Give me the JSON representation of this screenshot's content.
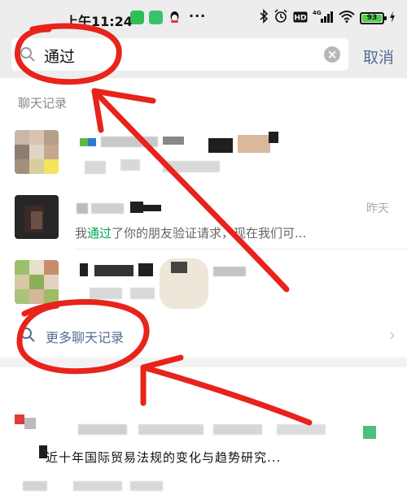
{
  "status_bar": {
    "time": "上午11:24",
    "more": "···",
    "battery": "93",
    "icons": [
      "wechat-icon",
      "green-app-icon",
      "qq-icon",
      "bluetooth-icon",
      "alarm-icon",
      "hd-icon",
      "signal-4g-icon",
      "wifi-icon",
      "battery-icon",
      "charging-icon"
    ]
  },
  "search": {
    "query": "通过",
    "cancel_label": "取消"
  },
  "section_title": "聊天记录",
  "results": [
    {
      "time": "",
      "snippet_pre": "",
      "snippet_hl": "",
      "snippet_post": ""
    },
    {
      "time": "昨天",
      "snippet_pre": "我",
      "snippet_hl": "通过",
      "snippet_post": "了你的朋友验证请求，现在我们可..."
    },
    {
      "time": "",
      "snippet_pre": "",
      "snippet_hl": "",
      "snippet_post": ""
    }
  ],
  "more_link": {
    "label": "更多聊天记录",
    "arrow": "›"
  },
  "bottom_result": {
    "title": "近十年国际贸易法规的变化与趋势研究..."
  },
  "colors": {
    "highlight": "#07a35a",
    "link": "#566b95",
    "annotation": "#e8231b"
  }
}
